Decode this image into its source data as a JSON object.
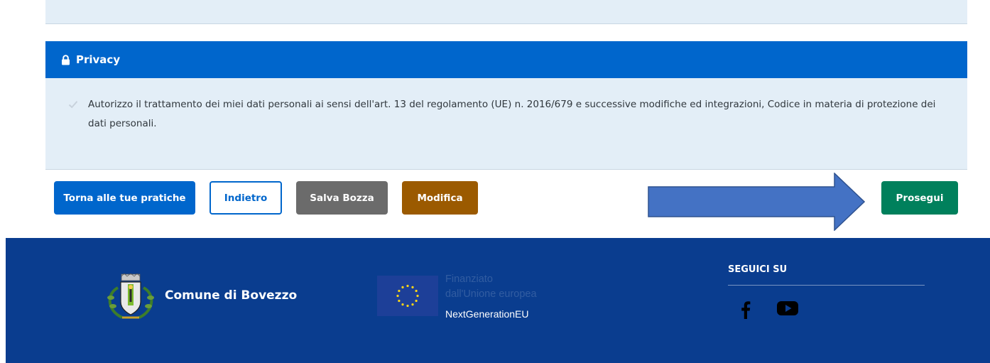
{
  "privacy": {
    "title": "Privacy",
    "consent_text": "Autorizzo il trattamento dei miei dati personali ai sensi dell'art. 13 del regolamento (UE) n. 2016/679 e successive modifiche ed integrazioni, Codice in materia di protezione dei dati personali.",
    "consent_checked": true
  },
  "actions": {
    "back_to_practices": "Torna alle tue pratiche",
    "back": "Indietro",
    "save_draft": "Salva Bozza",
    "edit": "Modifica",
    "continue": "Prosegui"
  },
  "footer": {
    "municipality_name": "Comune di Bovezzo",
    "eu_line_1": "Finanziato",
    "eu_line_2": "dall'Unione europea",
    "eu_program": "NextGenerationEU",
    "follow_title": "SEGUICI SU",
    "social": [
      "facebook-icon",
      "youtube-icon"
    ]
  },
  "colors": {
    "primary": "#0066cc",
    "footer_bg": "#0a3d8f",
    "panel_bg": "#e3eef7",
    "save_draft": "#6b6b6b",
    "edit": "#9b5a00",
    "continue": "#00805c",
    "annotation_arrow": "#4472c4"
  }
}
